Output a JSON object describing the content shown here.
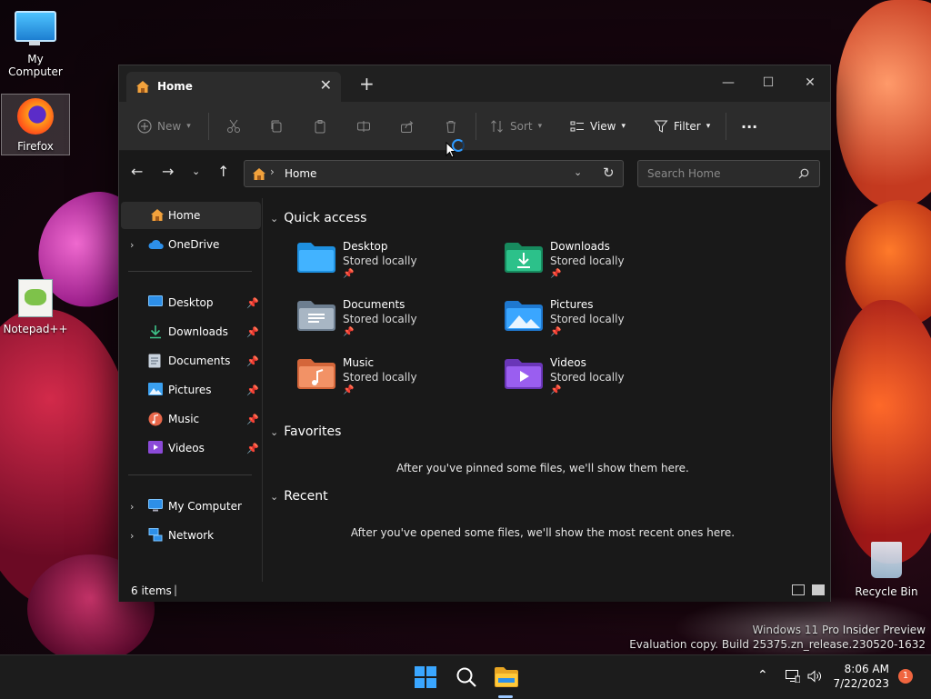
{
  "desktop": {
    "icons": {
      "my_computer": "My Computer",
      "firefox": "Firefox",
      "notepad": "Notepad++",
      "recycle_bin": "Recycle Bin"
    },
    "watermark_line1": "Windows 11 Pro Insider Preview",
    "watermark_line2": "Evaluation copy. Build 25375.zn_release.230520-1632"
  },
  "window": {
    "tab_title": "Home",
    "toolbar": {
      "new": "New",
      "sort": "Sort",
      "view": "View",
      "filter": "Filter"
    },
    "address": {
      "path": "Home",
      "search_placeholder": "Search Home"
    },
    "sidebar": {
      "home": "Home",
      "onedrive": "OneDrive",
      "desktop": "Desktop",
      "downloads": "Downloads",
      "documents": "Documents",
      "pictures": "Pictures",
      "music": "Music",
      "videos": "Videos",
      "my_computer": "My Computer",
      "network": "Network"
    },
    "content": {
      "quick_access_title": "Quick access",
      "quick_access": [
        {
          "name": "Desktop",
          "status": "Stored locally"
        },
        {
          "name": "Downloads",
          "status": "Stored locally"
        },
        {
          "name": "Documents",
          "status": "Stored locally"
        },
        {
          "name": "Pictures",
          "status": "Stored locally"
        },
        {
          "name": "Music",
          "status": "Stored locally"
        },
        {
          "name": "Videos",
          "status": "Stored locally"
        }
      ],
      "favorites_title": "Favorites",
      "favorites_empty": "After you've pinned some files, we'll show them here.",
      "recent_title": "Recent",
      "recent_empty": "After you've opened some files, we'll show the most recent ones here."
    },
    "status": {
      "item_count": "6 items"
    }
  },
  "taskbar": {
    "time": "8:06 AM",
    "date": "7/22/2023",
    "notification_count": "1"
  },
  "colors": {
    "accent": "#2f9bff",
    "window_bg": "#191919",
    "toolbar_bg": "#2c2c2c",
    "notification_badge": "#f0653f"
  }
}
